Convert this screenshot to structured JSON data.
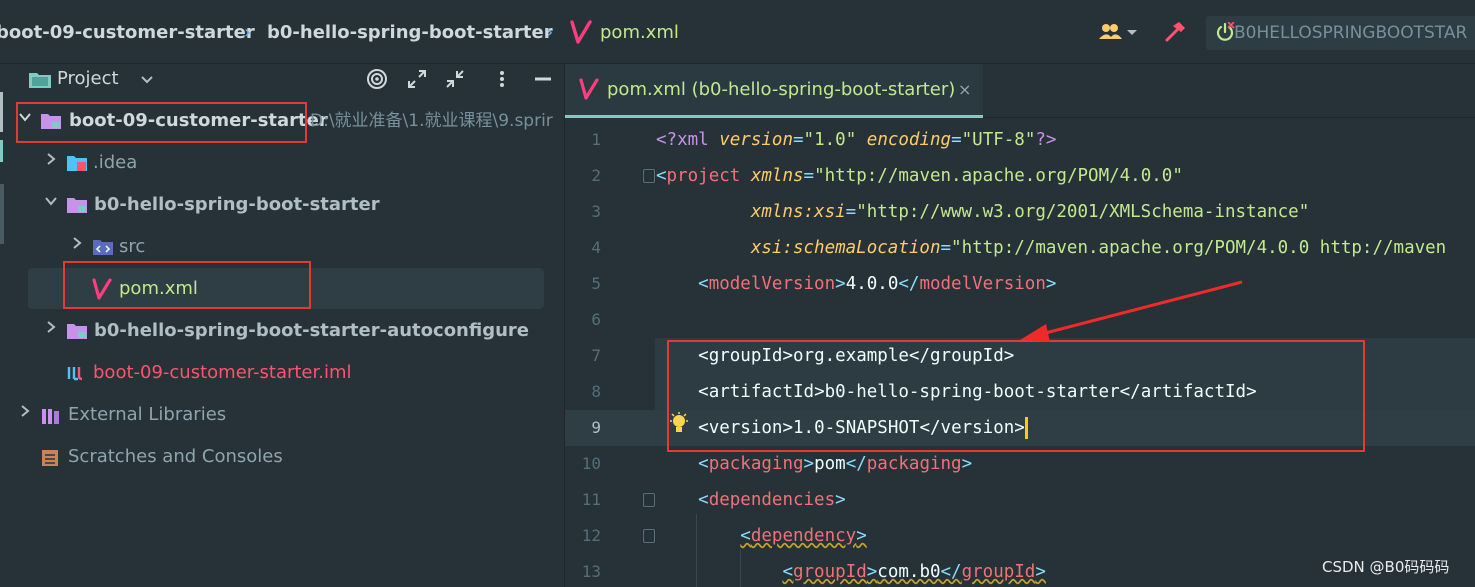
{
  "breadcrumbs": [
    {
      "label": "boot-09-customer-starter"
    },
    {
      "label": "b0-hello-spring-boot-starter"
    },
    {
      "label": "pom.xml"
    }
  ],
  "run_config": {
    "label": "B0HELLOSPRINGBOOTSTAR"
  },
  "project_panel": {
    "title": "Project",
    "tree": [
      {
        "label": "boot-09-customer-starter",
        "path": "D:\\就业准备\\1.就业课程\\9.sprir"
      },
      {
        "label": ".idea"
      },
      {
        "label": "b0-hello-spring-boot-starter"
      },
      {
        "label": "src"
      },
      {
        "label": "pom.xml"
      },
      {
        "label": "b0-hello-spring-boot-starter-autoconfigure"
      },
      {
        "label": "boot-09-customer-starter.iml"
      },
      {
        "label": "External Libraries"
      },
      {
        "label": "Scratches and Consoles"
      }
    ]
  },
  "editor": {
    "tab_label": "pom.xml (b0-hello-spring-boot-starter)",
    "tab_close": "×",
    "line_numbers": [
      "1",
      "2",
      "3",
      "4",
      "5",
      "6",
      "7",
      "8",
      "9",
      "10",
      "11",
      "12",
      "13"
    ],
    "current_line": "9",
    "code": {
      "l1_decl": "<?xml",
      "l1_a1": "version",
      "l1_v1": "\"1.0\"",
      "l1_a2": "encoding",
      "l1_v2": "\"UTF-8\"",
      "l1_end": "?>",
      "l2_tag": "project",
      "l2_attr": "xmlns",
      "l2_val": "\"http://maven.apache.org/POM/4.0.0\"",
      "l3_attr": "xmlns:xsi",
      "l3_val": "\"http://www.w3.org/2001/XMLSchema-instance\"",
      "l4_attr": "xsi:schemaLocation",
      "l4_val": "\"http://maven.apache.org/POM/4.0.0 http://maven",
      "l5_tag": "modelVersion",
      "l5_text": "4.0.0",
      "l7_tag": "groupId",
      "l7_text": "org.example",
      "l8_tag": "artifactId",
      "l8_text": "b0-hello-spring-boot-starter",
      "l9_tag": "version",
      "l9_text": "1.0-SNAPSHOT",
      "l10_tag": "packaging",
      "l10_text": "pom",
      "l11_tag": "dependencies",
      "l12_tag": "dependency",
      "l13_tag": "groupId",
      "l13_text": "com.b0"
    }
  },
  "watermark": "CSDN @B0码码码",
  "colors": {
    "background": "#263238",
    "accent": "#80cbc4",
    "annotation_red": "#e53935",
    "tag": "#f07178",
    "string": "#c3e88d",
    "attribute": "#ffcb6b"
  }
}
